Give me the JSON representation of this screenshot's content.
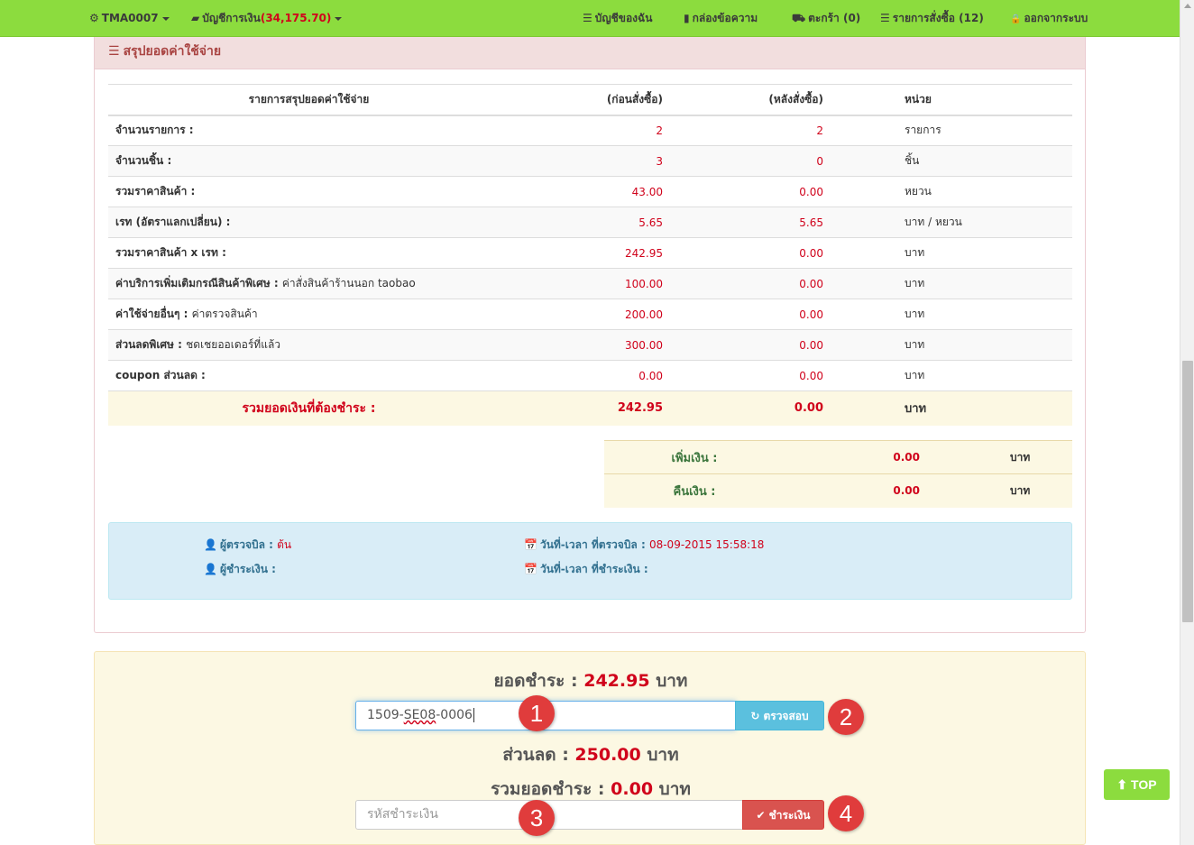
{
  "nav": {
    "user": "TMA0007",
    "account_label": "บัญชีการเงิน",
    "account_balance": "(34,175.70)",
    "my_account": "บัญชีของฉัน",
    "messages": "กล่องข้อความ",
    "cart": "ตะกร้า (0)",
    "orders": "รายการสั่งซื้อ (12)",
    "logout": "ออกจากระบบ"
  },
  "panel": {
    "title": "สรุปยอดค่าใช้จ่าย",
    "headers": {
      "label": "รายการสรุปยอดค่าใช้จ่าย",
      "before": "(ก่อนสั่งซื้อ)",
      "after": "(หลังสั่งซื้อ)",
      "unit": "หน่วย"
    },
    "rows": [
      {
        "label": "จำนวนรายการ :",
        "sub": "",
        "before": "2",
        "after": "2",
        "unit": "รายการ"
      },
      {
        "label": "จำนวนชิ้น :",
        "sub": "",
        "before": "3",
        "after": "0",
        "unit": "ชิ้น"
      },
      {
        "label": "รวมราคาสินค้า :",
        "sub": "",
        "before": "43.00",
        "after": "0.00",
        "unit": "หยวน"
      },
      {
        "label": "เรท (อัตราแลกเปลี่ยน) :",
        "sub": "",
        "before": "5.65",
        "after": "5.65",
        "unit": "บาท / หยวน"
      },
      {
        "label": "รวมราคาสินค้า x เรท :",
        "sub": "",
        "before": "242.95",
        "after": "0.00",
        "unit": "บาท"
      },
      {
        "label": "ค่าบริการเพิ่มเติมกรณีสินค้าพิเศษ :",
        "sub": "ค่าสั่งสินค้าร้านนอก taobao",
        "before": "100.00",
        "after": "0.00",
        "unit": "บาท"
      },
      {
        "label": "ค่าใช้จ่ายอื่นๆ :",
        "sub": "ค่าตรวจสินค้า",
        "before": "200.00",
        "after": "0.00",
        "unit": "บาท"
      },
      {
        "label": "ส่วนลดพิเศษ :",
        "sub": "ชดเชยออเดอร์ที่แล้ว",
        "before": "300.00",
        "after": "0.00",
        "unit": "บาท"
      },
      {
        "label": "coupon ส่วนลด :",
        "sub": "",
        "before": "0.00",
        "after": "0.00",
        "unit": "บาท"
      }
    ],
    "total": {
      "label": "รวมยอดเงินที่ต้องชำระ :",
      "before": "242.95",
      "after": "0.00",
      "unit": "บาท"
    },
    "extra": [
      {
        "label": "เพิ่มเงิน :",
        "value": "0.00",
        "unit": "บาท"
      },
      {
        "label": "คืนเงิน :",
        "value": "0.00",
        "unit": "บาท"
      }
    ],
    "info": {
      "checker_label": "ผู้ตรวจบิล :",
      "checker_value": "ต้น",
      "check_time_label": "วันที่-เวลา ที่ตรวจบิล :",
      "check_time_value": "08-09-2015 15:58:18",
      "payer_label": "ผู้ชำระเงิน :",
      "payer_value": "",
      "pay_time_label": "วันที่-เวลา ที่ชำระเงิน :",
      "pay_time_value": ""
    }
  },
  "payment": {
    "amount_label": "ยอดชำระ :",
    "amount_value": "242.95",
    "amount_unit": "บาท",
    "coupon_value_part1": "1509-",
    "coupon_value_part2": "SE08",
    "coupon_value_part3": "-0006",
    "check_button": "ตรวจสอบ",
    "discount_label": "ส่วนลด :",
    "discount_value": "250.00",
    "discount_unit": "บาท",
    "total_label": "รวมยอดชำระ :",
    "total_value": "0.00",
    "total_unit": "บาท",
    "pay_code_placeholder": "รหัสชำระเงิน",
    "pay_button": "ชำระเงิน"
  },
  "markers": [
    "1",
    "2",
    "3",
    "4"
  ],
  "top_button": "TOP",
  "icons": {
    "gear": "⚙",
    "wallet": "▰",
    "list": "☰",
    "comment": "▮",
    "cart": "⛟",
    "lock": "🔒",
    "user": "👤",
    "calendar": "📅",
    "refresh": "↻",
    "check": "✔",
    "arrow_up": "⬆"
  },
  "colors": {
    "nav_green": "#8cdc3e",
    "danger": "#d9534f",
    "info": "#5bc0de",
    "marker": "#e03c3c"
  }
}
